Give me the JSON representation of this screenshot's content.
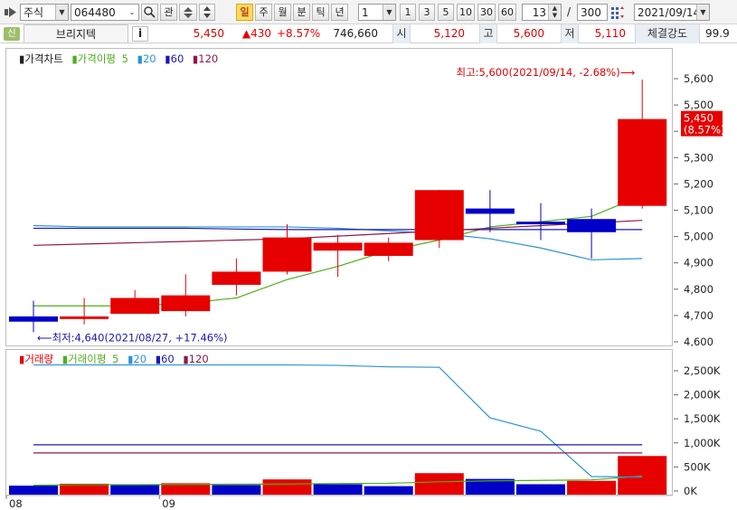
{
  "toolbar": {
    "market": "주식",
    "code": "064480",
    "btn_gwan": "관",
    "periods": [
      "일",
      "주",
      "월",
      "분",
      "틱",
      "년"
    ],
    "period_selected": "일",
    "unit_value": "1",
    "quick_units": [
      "1",
      "3",
      "5",
      "10",
      "30",
      "60"
    ],
    "count_value": "13",
    "count_slash": "/",
    "count_max": "300",
    "date_value": "2021/09/14"
  },
  "info": {
    "badge": "신",
    "name": "브리지텍",
    "info_btn": "i",
    "price": "5,450",
    "change": "▲430",
    "change_pct": "+8.57%",
    "volume": "746,660",
    "open_label": "시",
    "open": "5,120",
    "high_label": "고",
    "high": "5,600",
    "low_label": "저",
    "low": "5,110",
    "strength_label": "체결강도",
    "strength": "99.9"
  },
  "price_chart": {
    "legend": {
      "title": "가격차트",
      "ma_title": "가격이평",
      "ma1": "5",
      "ma2": "20",
      "ma3": "60",
      "ma4": "120"
    },
    "high_annotation": "최고:5,600(2021/09/14, -2.68%)",
    "high_arrow": "⟶",
    "low_annotation": "최저:4,640(2021/08/27, +17.46%)",
    "low_arrow": "⟵",
    "current_price_tag": "5,450",
    "current_pct_tag": "(8.57%)"
  },
  "volume_chart": {
    "legend": {
      "title": "거래량",
      "ma_title": "거래이평",
      "ma1": "5",
      "ma2": "20",
      "ma3": "60",
      "ma4": "120"
    }
  },
  "x_axis": {
    "labels": [
      {
        "text": "08",
        "index": 0
      },
      {
        "text": "09",
        "index": 3
      }
    ]
  },
  "colors": {
    "up": "#e60000",
    "down": "#0000c8",
    "ma5": "#4caf1c",
    "ma20": "#2b93d6",
    "ma60": "#1a1ab0",
    "ma120": "#8b1a4a",
    "tag_bg": "#e60000"
  },
  "chart_data": [
    {
      "type": "candlestick",
      "title": "가격차트",
      "ylim": [
        4600,
        5650
      ],
      "yticks": [
        4600,
        4700,
        4800,
        4900,
        5000,
        5100,
        5200,
        5300,
        5400,
        5500,
        5600
      ],
      "ytick_labels": [
        "4,600",
        "4,700",
        "4,800",
        "4,900",
        "5,000",
        "5,100",
        "5,200",
        "5,300",
        "5,400",
        "5,500",
        "5,600"
      ],
      "candles": [
        {
          "o": 4700,
          "h": 4760,
          "l": 4640,
          "c": 4680
        },
        {
          "o": 4690,
          "h": 4770,
          "l": 4670,
          "c": 4700
        },
        {
          "o": 4710,
          "h": 4800,
          "l": 4710,
          "c": 4770
        },
        {
          "o": 4720,
          "h": 4860,
          "l": 4700,
          "c": 4780
        },
        {
          "o": 4820,
          "h": 4920,
          "l": 4780,
          "c": 4870
        },
        {
          "o": 4870,
          "h": 5050,
          "l": 4860,
          "c": 5000
        },
        {
          "o": 4950,
          "h": 5010,
          "l": 4850,
          "c": 4980
        },
        {
          "o": 4930,
          "h": 5000,
          "l": 4910,
          "c": 4980
        },
        {
          "o": 4990,
          "h": 5180,
          "l": 4960,
          "c": 5180
        },
        {
          "o": 5110,
          "h": 5180,
          "l": 5020,
          "c": 5090
        },
        {
          "o": 5060,
          "h": 5130,
          "l": 4990,
          "c": 5050
        },
        {
          "o": 5070,
          "h": 5110,
          "l": 4920,
          "c": 5020
        },
        {
          "o": 5120,
          "h": 5600,
          "l": 5110,
          "c": 5450
        }
      ],
      "series": [
        {
          "name": "5",
          "values": [
            4740,
            4740,
            4740,
            4750,
            4770,
            4840,
            4890,
            4950,
            4990,
            5040,
            5060,
            5080,
            5160
          ]
        },
        {
          "name": "20",
          "values": [
            5045,
            5040,
            5040,
            5040,
            5040,
            5040,
            5035,
            5025,
            5015,
            4995,
            4960,
            4915,
            4920
          ]
        },
        {
          "name": "60",
          "values": [
            5035,
            5035,
            5035,
            5035,
            5032,
            5030,
            5030,
            5030,
            5030,
            5030,
            5030,
            5030,
            5030
          ]
        },
        {
          "name": "120",
          "values": [
            4970,
            4975,
            4980,
            4985,
            4990,
            4995,
            5005,
            5015,
            5025,
            5035,
            5045,
            5055,
            5065
          ]
        }
      ]
    },
    {
      "type": "bar",
      "title": "거래량",
      "ylim": [
        0,
        2800000
      ],
      "yticks": [
        0,
        500000,
        1000000,
        1500000,
        2000000,
        2500000
      ],
      "ytick_labels": [
        "0K",
        "500K",
        "1,000K",
        "1,500K",
        "2,000K",
        "2,500K"
      ],
      "values": [
        130000,
        170000,
        140000,
        180000,
        145000,
        260000,
        160000,
        120000,
        390000,
        270000,
        160000,
        230000,
        746660
      ],
      "up": [
        false,
        true,
        false,
        true,
        false,
        true,
        false,
        false,
        true,
        false,
        false,
        true,
        true
      ],
      "series": [
        {
          "name": "5",
          "values": [
            140000,
            150000,
            150000,
            155000,
            160000,
            165000,
            175000,
            180000,
            210000,
            230000,
            240000,
            250000,
            330000
          ]
        },
        {
          "name": "20",
          "values": [
            2640000,
            2640000,
            2640000,
            2640000,
            2640000,
            2640000,
            2630000,
            2600000,
            2590000,
            1540000,
            1260000,
            320000,
            310000
          ]
        },
        {
          "name": "60",
          "values": [
            980000,
            980000,
            980000,
            980000,
            980000,
            980000,
            980000,
            980000,
            980000,
            980000,
            980000,
            980000,
            980000
          ]
        },
        {
          "name": "120",
          "values": [
            810000,
            810000,
            810000,
            810000,
            810000,
            810000,
            810000,
            810000,
            810000,
            810000,
            810000,
            810000,
            810000
          ]
        }
      ]
    }
  ]
}
